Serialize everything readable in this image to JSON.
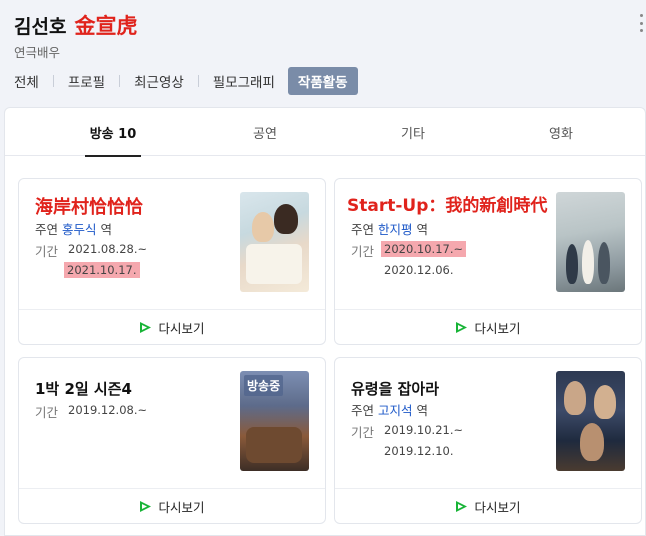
{
  "profile": {
    "name": "김선호",
    "hanja": "金宣虎",
    "job": "연극배우"
  },
  "nav": [
    {
      "label": "전체"
    },
    {
      "label": "프로필"
    },
    {
      "label": "최근영상"
    },
    {
      "label": "필모그래피"
    },
    {
      "label": "작품활동",
      "active": true
    }
  ],
  "tabs": [
    {
      "label": "방송 10",
      "active": true
    },
    {
      "label": "공연"
    },
    {
      "label": "기타"
    },
    {
      "label": "영화"
    }
  ],
  "cards": [
    {
      "title": "海岸村恰恰恰",
      "role_prefix": "주연",
      "character": "홍두식",
      "role_suffix": "역",
      "period_label": "기간",
      "start": "2021.08.28.~",
      "end": "2021.10.17.",
      "watch_label": "다시보기"
    },
    {
      "title": "Start-Up：我的新創時代",
      "role_prefix": "주연",
      "character": "한지평",
      "role_suffix": "역",
      "period_label": "기간",
      "start": "2020.10.17.~",
      "end": "2020.12.06.",
      "watch_label": "다시보기"
    },
    {
      "title": "1박 2일 시즌4",
      "period_label": "기간",
      "start": "2019.12.08.~",
      "badge": "방송중",
      "watch_label": "다시보기"
    },
    {
      "title": "유령을 잡아라",
      "role_prefix": "주연",
      "character": "고지석",
      "role_suffix": "역",
      "period_label": "기간",
      "start": "2019.10.21.~",
      "end": "2019.12.10.",
      "watch_label": "다시보기"
    }
  ],
  "colors": {
    "accent_red": "#e0231c",
    "nav_active_bg": "#7a8ca8",
    "highlight": "#f5a8ae",
    "character_link": "#1d58c8",
    "play_green": "#18b437"
  }
}
